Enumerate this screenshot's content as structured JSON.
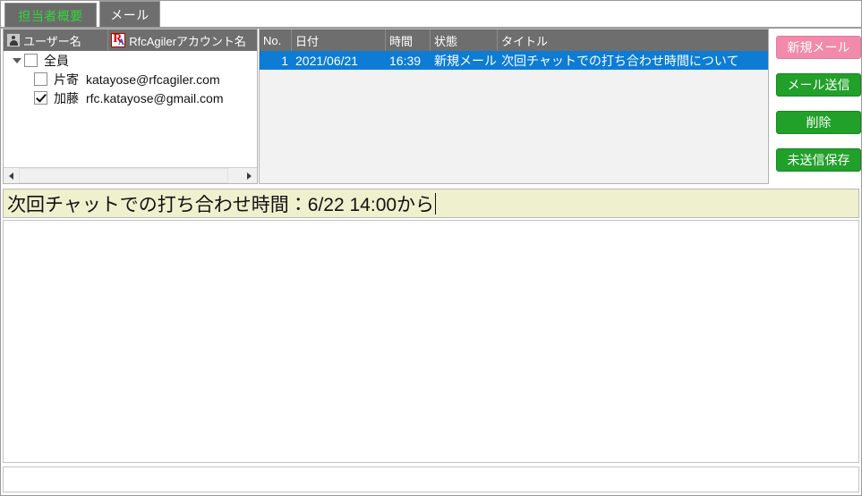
{
  "window": {
    "tabs": [
      {
        "label": "担当者概要",
        "active": false
      },
      {
        "label": "メール",
        "active": true
      }
    ]
  },
  "user_panel": {
    "columns": [
      {
        "label": "ユーザー名",
        "icon": "person-icon"
      },
      {
        "label": "RfcAgilerアカウント名",
        "icon": "rfcagiler-logo-icon"
      }
    ],
    "logo": {
      "letter_primary": "R",
      "letter_secondary": "A"
    },
    "tree": {
      "root": {
        "label": "全員",
        "checked": false,
        "expanded": true
      },
      "children": [
        {
          "name": "片寄",
          "account": "katayose@rfcagiler.com",
          "checked": false
        },
        {
          "name": "加藤",
          "account": "rfc.katayose@gmail.com",
          "checked": true
        }
      ]
    }
  },
  "mail_list": {
    "columns": [
      "No.",
      "日付",
      "時間",
      "状態",
      "タイトル"
    ],
    "rows": [
      {
        "no": "1",
        "date": "2021/06/21",
        "time": "16:39",
        "state": "新規メール",
        "title": "次回チャットでの打ち合わせ時間について",
        "selected": true
      }
    ]
  },
  "actions": {
    "buttons": [
      {
        "label": "新規メール",
        "style": "pink"
      },
      {
        "label": "メール送信",
        "style": "green"
      },
      {
        "label": "削除",
        "style": "green"
      },
      {
        "label": "未送信保存",
        "style": "green"
      }
    ]
  },
  "editor": {
    "subject_value": "次回チャットでの打ち合わせ時間：6/22 14:00から",
    "subject_placeholder": "",
    "body_value": "",
    "body_placeholder": ""
  },
  "status_bar": {
    "text": ""
  },
  "colors": {
    "tab_active_bg": "#6e6e6e",
    "tab_inactive_text": "#31d43a",
    "header_bg": "#6e6e6e",
    "selection_bg": "#0c7cd5",
    "button_pink": "#f18aab",
    "button_green": "#21a02a",
    "subject_bg": "#eff0cd"
  }
}
